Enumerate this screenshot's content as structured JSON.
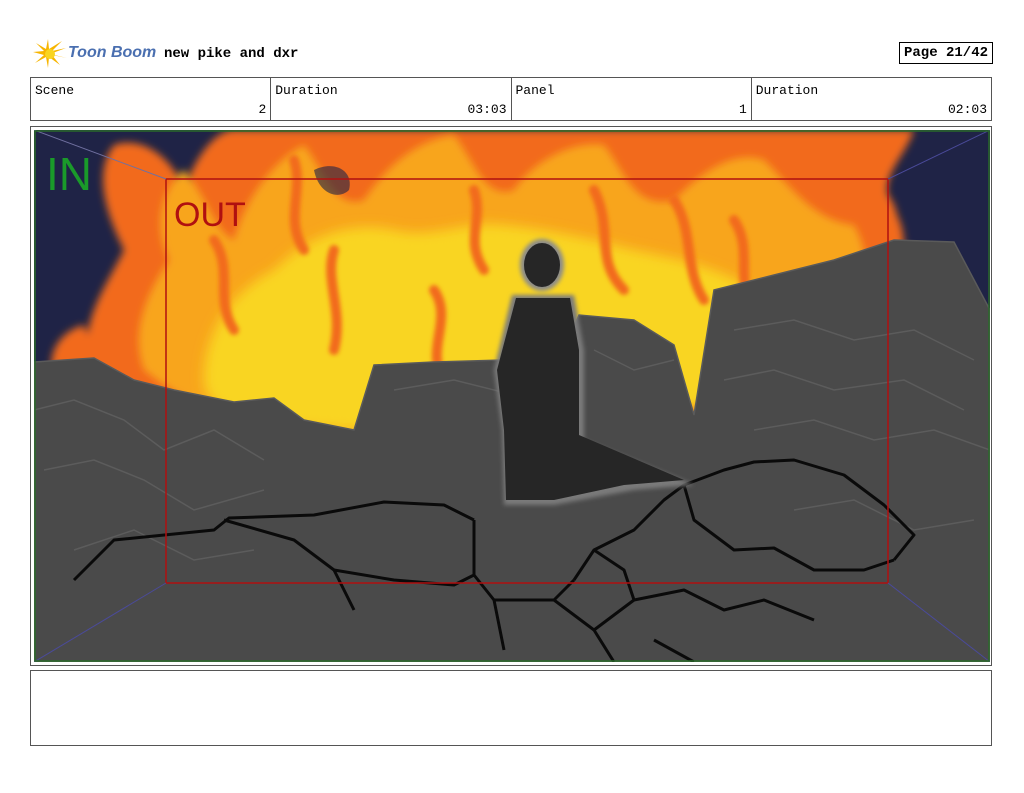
{
  "header": {
    "logo_text": "Toon Boom",
    "project_title": "new pike and dxr",
    "page_label": "Page 21/42"
  },
  "info": {
    "scene_label": "Scene",
    "scene_value": "2",
    "scene_duration_label": "Duration",
    "scene_duration_value": "03:03",
    "panel_label": "Panel",
    "panel_value": "1",
    "panel_duration_label": "Duration",
    "panel_duration_value": "02:03"
  },
  "panel": {
    "in_label": "IN",
    "out_label": "OUT",
    "colors": {
      "sky": "#1f2346",
      "fire_outer": "#f26a1b",
      "fire_mid": "#f8a51e",
      "fire_core": "#f9d520",
      "rocks": "#4a4a4a",
      "figure": "#262626",
      "in_color": "#1a9a2a",
      "out_color": "#b01010"
    }
  },
  "notes": {
    "text": ""
  }
}
